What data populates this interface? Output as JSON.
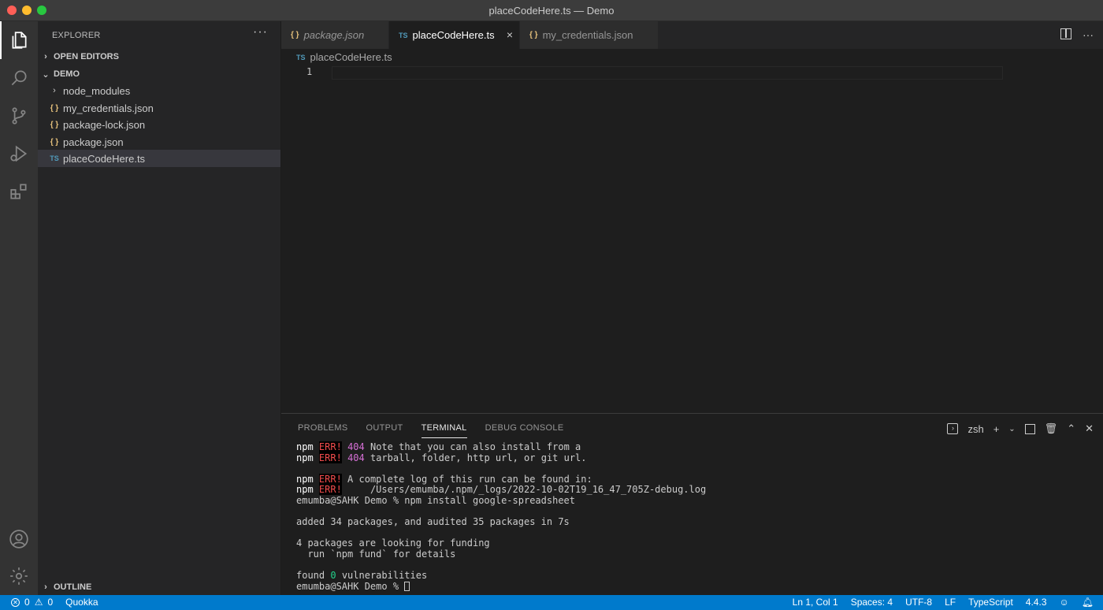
{
  "window": {
    "title": "placeCodeHere.ts — Demo"
  },
  "sidebar": {
    "header": "EXPLORER",
    "more": "···",
    "open_editors": "OPEN EDITORS",
    "folder": "DEMO",
    "items": [
      {
        "label": "node_modules",
        "type": "folder",
        "icon": "›"
      },
      {
        "label": "my_credentials.json",
        "type": "json",
        "icon": "{ }"
      },
      {
        "label": "package-lock.json",
        "type": "json",
        "icon": "{ }"
      },
      {
        "label": "package.json",
        "type": "json",
        "icon": "{ }"
      },
      {
        "label": "placeCodeHere.ts",
        "type": "ts",
        "icon": "TS"
      }
    ],
    "outline": "OUTLINE"
  },
  "tabs": [
    {
      "label": "package.json",
      "icon": "{ }"
    },
    {
      "label": "placeCodeHere.ts",
      "icon": "TS",
      "close": "×"
    },
    {
      "label": "my_credentials.json",
      "icon": "{ }"
    }
  ],
  "breadcrumb": {
    "icon": "TS",
    "file": "placeCodeHere.ts"
  },
  "editor": {
    "line_number": "1"
  },
  "panel": {
    "tabs": [
      "PROBLEMS",
      "OUTPUT",
      "TERMINAL",
      "DEBUG CONSOLE"
    ],
    "shell": "zsh",
    "terminal": {
      "npm": "npm",
      "err": "ERR!",
      "code404": "404",
      "l1": " Note that you can also install from a",
      "l2": " tarball, folder, http url, or git url.",
      "l3": " A complete log of this run can be found in:",
      "l4": "     /Users/emumba/.npm/_logs/2022-10-02T19_16_47_705Z-debug.log",
      "l5": "emumba@SAHK Demo % npm install google-spreadsheet",
      "l6": "added 34 packages, and audited 35 packages in 7s",
      "l7": "4 packages are looking for funding",
      "l8": "  run `npm fund` for details",
      "l9a": "found ",
      "l9b": "0",
      "l9c": " vulnerabilities",
      "l10": "emumba@SAHK Demo % "
    }
  },
  "statusbar": {
    "errors": "0",
    "warnings": "0",
    "quokka": "Quokka",
    "position": "Ln 1, Col 1",
    "spaces": "Spaces: 4",
    "encoding": "UTF-8",
    "eol": "LF",
    "language": "TypeScript",
    "version": "4.4.3"
  }
}
